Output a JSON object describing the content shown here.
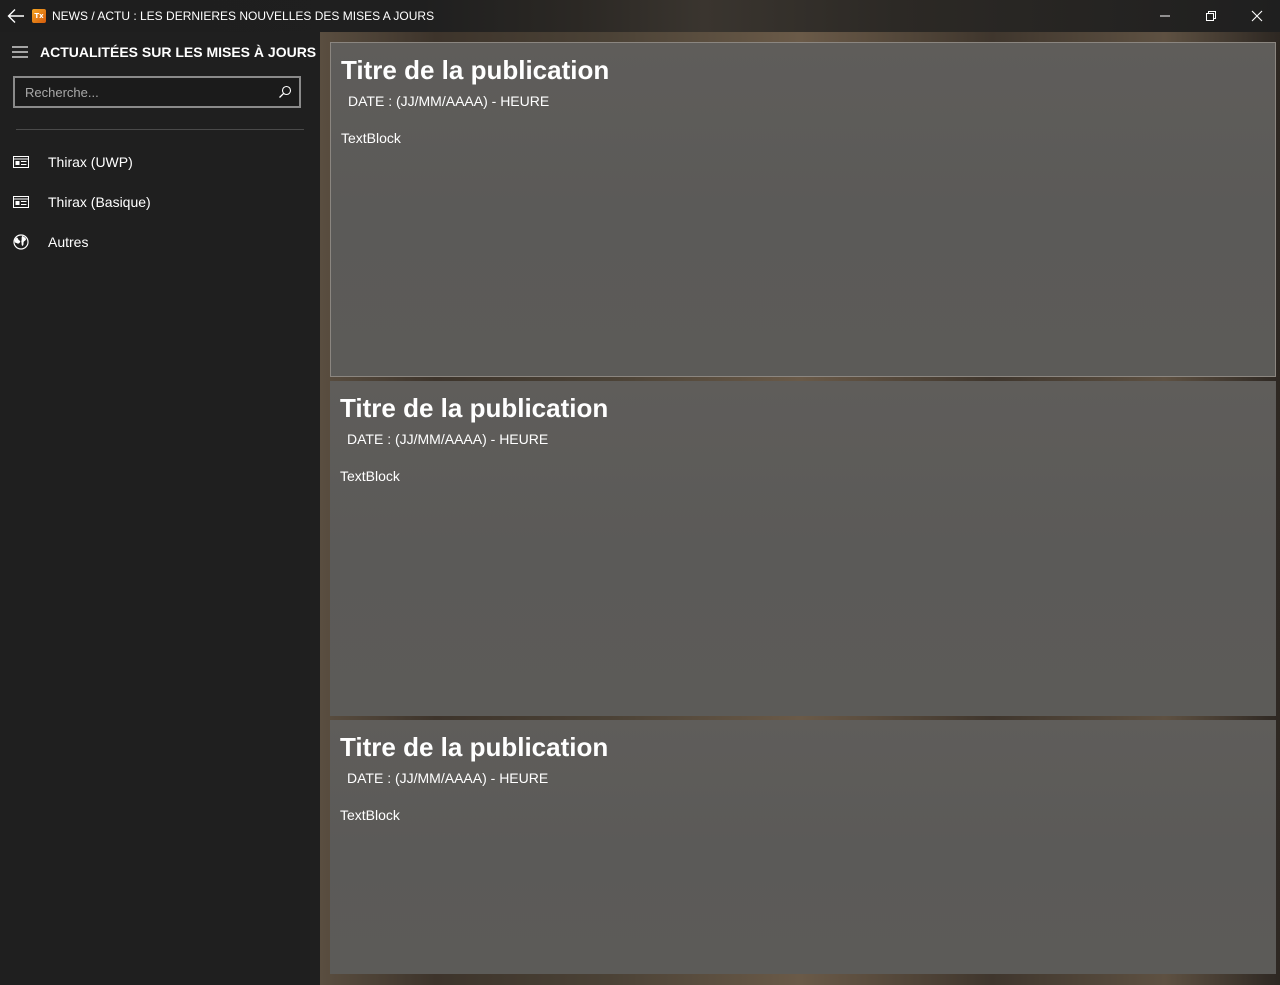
{
  "window": {
    "title": "NEWS / ACTU : LES DERNIERES NOUVELLES DES MISES A JOURS",
    "logo_text": "Tx",
    "icons": {
      "back": "back-arrow-icon",
      "minimize": "minimize-icon",
      "maximize": "restore-icon",
      "close": "close-icon"
    }
  },
  "sidebar": {
    "title": "ACTUALITÉES SUR LES MISES À JOURS",
    "menu_icon": "hamburger-icon",
    "search": {
      "placeholder": "Recherche...",
      "value": "",
      "icon": "search-icon"
    },
    "items": [
      {
        "label": "Thirax (UWP)",
        "icon": "news-icon"
      },
      {
        "label": "Thirax (Basique)",
        "icon": "news-icon"
      },
      {
        "label": "Autres",
        "icon": "globe-icon"
      }
    ]
  },
  "posts": [
    {
      "title": "Titre de la publication",
      "date": "DATE : (JJ/MM/AAAA) - HEURE",
      "body": "TextBlock"
    },
    {
      "title": "Titre de la publication",
      "date": "DATE : (JJ/MM/AAAA) - HEURE",
      "body": "TextBlock"
    },
    {
      "title": "Titre de la publication",
      "date": "DATE : (JJ/MM/AAAA) - HEURE",
      "body": "TextBlock"
    }
  ],
  "colors": {
    "sidebar_bg": "#1f1f1f",
    "card_bg": "#5c5b58",
    "text": "#ffffff",
    "logo_accent": "#e8891b"
  }
}
